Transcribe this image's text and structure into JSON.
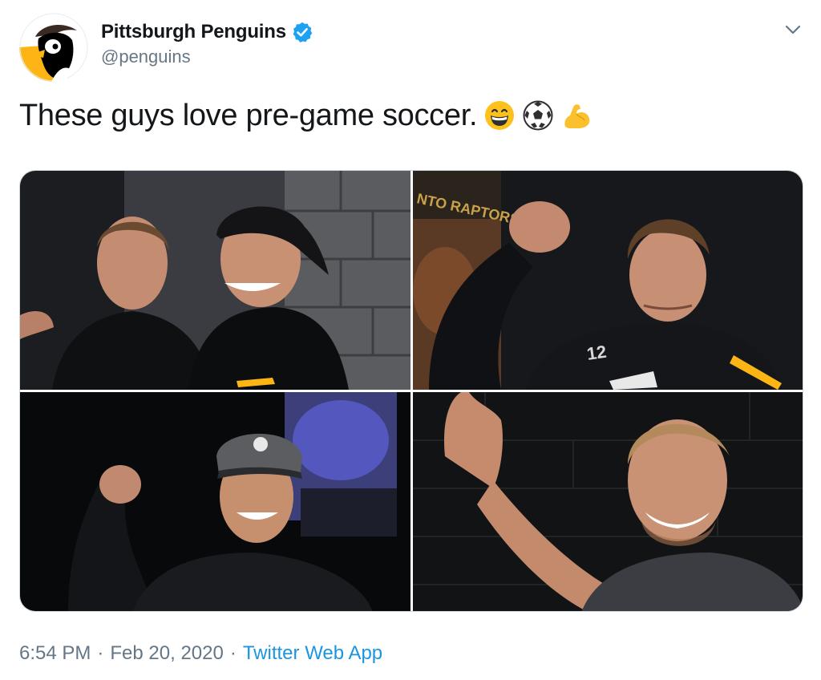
{
  "author": {
    "display_name": "Pittsburgh Penguins",
    "handle": "@penguins",
    "verified": true,
    "verified_color": "#1da1f2",
    "avatar_icon": "penguins-logo-icon",
    "brand_gold": "#fcb514",
    "brand_black": "#000000"
  },
  "tweet": {
    "text": "These guys love pre-game soccer.",
    "emojis": [
      "grinning-face-icon",
      "soccer-ball-icon",
      "flexed-biceps-icon"
    ]
  },
  "media": {
    "photo_count": 4,
    "photos": [
      {
        "id": "photo-1",
        "description_icon": "two-players-laughing-photo",
        "visible_text": ""
      },
      {
        "id": "photo-2",
        "description_icon": "player-raising-fist-photo",
        "visible_text": "NTO RAPTORS",
        "jersey_number": "12"
      },
      {
        "id": "photo-3",
        "description_icon": "player-in-cap-fist-pump-photo",
        "visible_text": ""
      },
      {
        "id": "photo-4",
        "description_icon": "player-high-five-photo",
        "visible_text": ""
      }
    ]
  },
  "meta": {
    "time": "6:54 PM",
    "separator": "·",
    "date": "Feb 20, 2020",
    "source": "Twitter Web App",
    "link_color": "#1b95e0"
  },
  "menu": {
    "icon": "chevron-down-icon"
  }
}
